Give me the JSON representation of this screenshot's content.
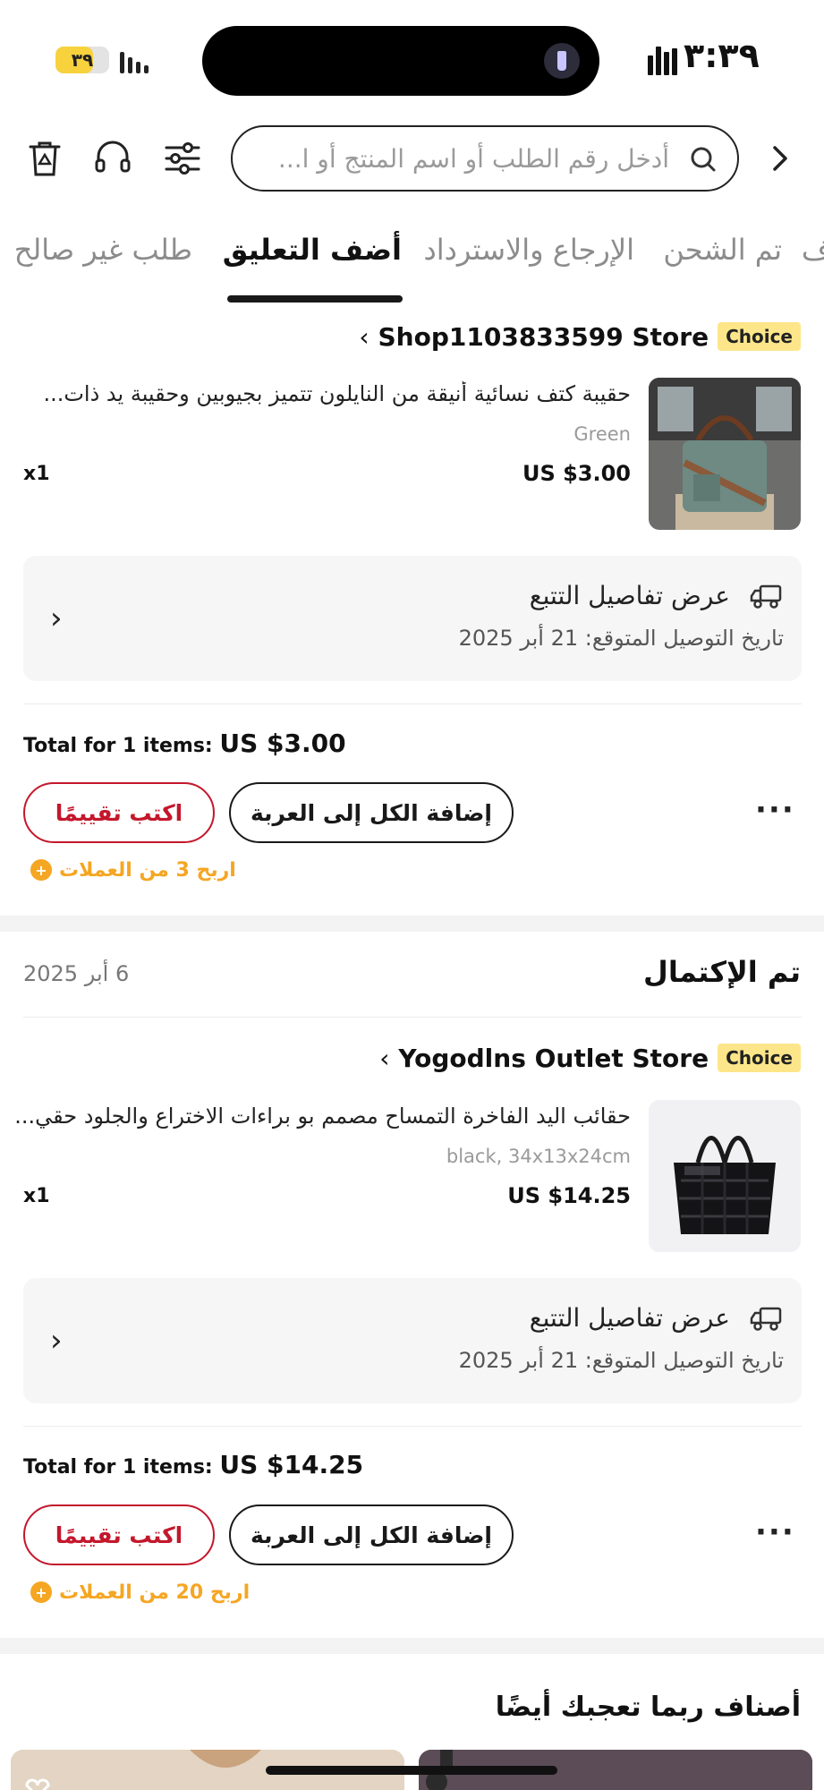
{
  "status_bar": {
    "battery": "٣٩",
    "time": "٣:٣٩"
  },
  "search": {
    "placeholder": "أدخل رقم الطلب أو اسم المنتج أو ا..."
  },
  "tabs": [
    {
      "label": "طلب غير صالح",
      "active": false
    },
    {
      "label": "أضف التعليق",
      "active": true
    },
    {
      "label": "الإرجاع والاسترداد",
      "active": false
    },
    {
      "label": "تم الشحن",
      "active": false
    },
    {
      "label": "ف",
      "active": false
    }
  ],
  "orders": [
    {
      "status": "",
      "date": "",
      "store_badge": "Choice",
      "store_name": "Shop1103833599 Store",
      "product": {
        "title": "حقيبة كتف نسائية أنيقة من النايلون تتميز بجيوبين وحقيبة يد ذات...",
        "variant": "Green",
        "price": "US $3.00",
        "qty": "x1"
      },
      "tracking": {
        "title": "عرض تفاصيل التتبع",
        "date": "تاريخ التوصيل المتوقع: 21 أبر 2025"
      },
      "total_label": "Total for 1 items:",
      "total_amount": "US $3.00",
      "cart_button": "إضافة الكل إلى العربة",
      "review_button": "اكتب تقييمًا",
      "more": "···",
      "coins": "اربح 3 من العملات"
    },
    {
      "status": "تم الإكتمال",
      "date": "6 أبر 2025",
      "store_badge": "Choice",
      "store_name": "Yogodlns Outlet Store",
      "product": {
        "title": "حقائب اليد الفاخرة التمساح مصمم بو براءات الاختراع والجلود حقي...",
        "variant": "black, 34x13x24cm",
        "price": "US $14.25",
        "qty": "x1"
      },
      "tracking": {
        "title": "عرض تفاصيل التتبع",
        "date": "تاريخ التوصيل المتوقع: 21 أبر 2025"
      },
      "total_label": "Total for 1 items:",
      "total_amount": "US $14.25",
      "cart_button": "إضافة الكل إلى العربة",
      "review_button": "اكتب تقييمًا",
      "more": "···",
      "coins": "اربح 20 من العملات"
    }
  ],
  "recommendations": {
    "title": "أصناف ربما تعجبك أيضًا"
  },
  "colors": {
    "accent_red": "#c4172c",
    "coin_orange": "#f5a623",
    "choice_badge": "#fde68a"
  }
}
